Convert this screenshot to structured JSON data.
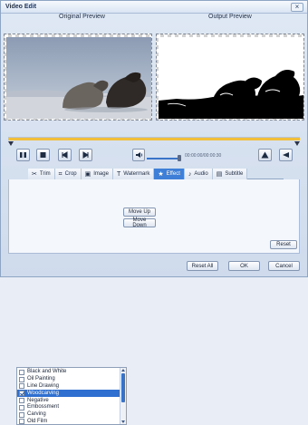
{
  "window": {
    "title": "Video Edit",
    "close_symbol": "×"
  },
  "previews": {
    "original_label": "Original Preview",
    "output_label": "Output Preview"
  },
  "timeline": {
    "progress": 1.0
  },
  "playback": {
    "time": "00:00:00/00:00:30",
    "volume": 1.0
  },
  "tabs": [
    {
      "label": "Trim",
      "icon": "scissors-icon",
      "glyph": "✂"
    },
    {
      "label": "Crop",
      "icon": "crop-icon",
      "glyph": "⌗"
    },
    {
      "label": "Image",
      "icon": "image-icon",
      "glyph": "▣"
    },
    {
      "label": "Watermark",
      "icon": "watermark-icon",
      "glyph": "T"
    },
    {
      "label": "Effect",
      "icon": "star-icon",
      "glyph": "★"
    },
    {
      "label": "Audio",
      "icon": "music-note-icon",
      "glyph": "♪"
    },
    {
      "label": "Subtitle",
      "icon": "subtitle-icon",
      "glyph": "▤"
    }
  ],
  "active_tab": "Effect",
  "effects": [
    {
      "label": "Black and White",
      "checked": false
    },
    {
      "label": "Oil Painting",
      "checked": false
    },
    {
      "label": "Line Drawing",
      "checked": false
    },
    {
      "label": "Woodcarving",
      "checked": true,
      "selected": true
    },
    {
      "label": "Negative",
      "checked": false
    },
    {
      "label": "Embossment",
      "checked": false
    },
    {
      "label": "Carving",
      "checked": false
    },
    {
      "label": "Old Film",
      "checked": false
    }
  ],
  "buttons": {
    "move_up": "Move Up",
    "move_down": "Move Down",
    "reset": "Reset",
    "reset_all": "Reset All",
    "ok": "OK",
    "cancel": "Cancel"
  },
  "colors": {
    "accent": "#3f7fd8",
    "timeline_fill": "#f2bf3a",
    "selection": "#2e6fd0"
  }
}
